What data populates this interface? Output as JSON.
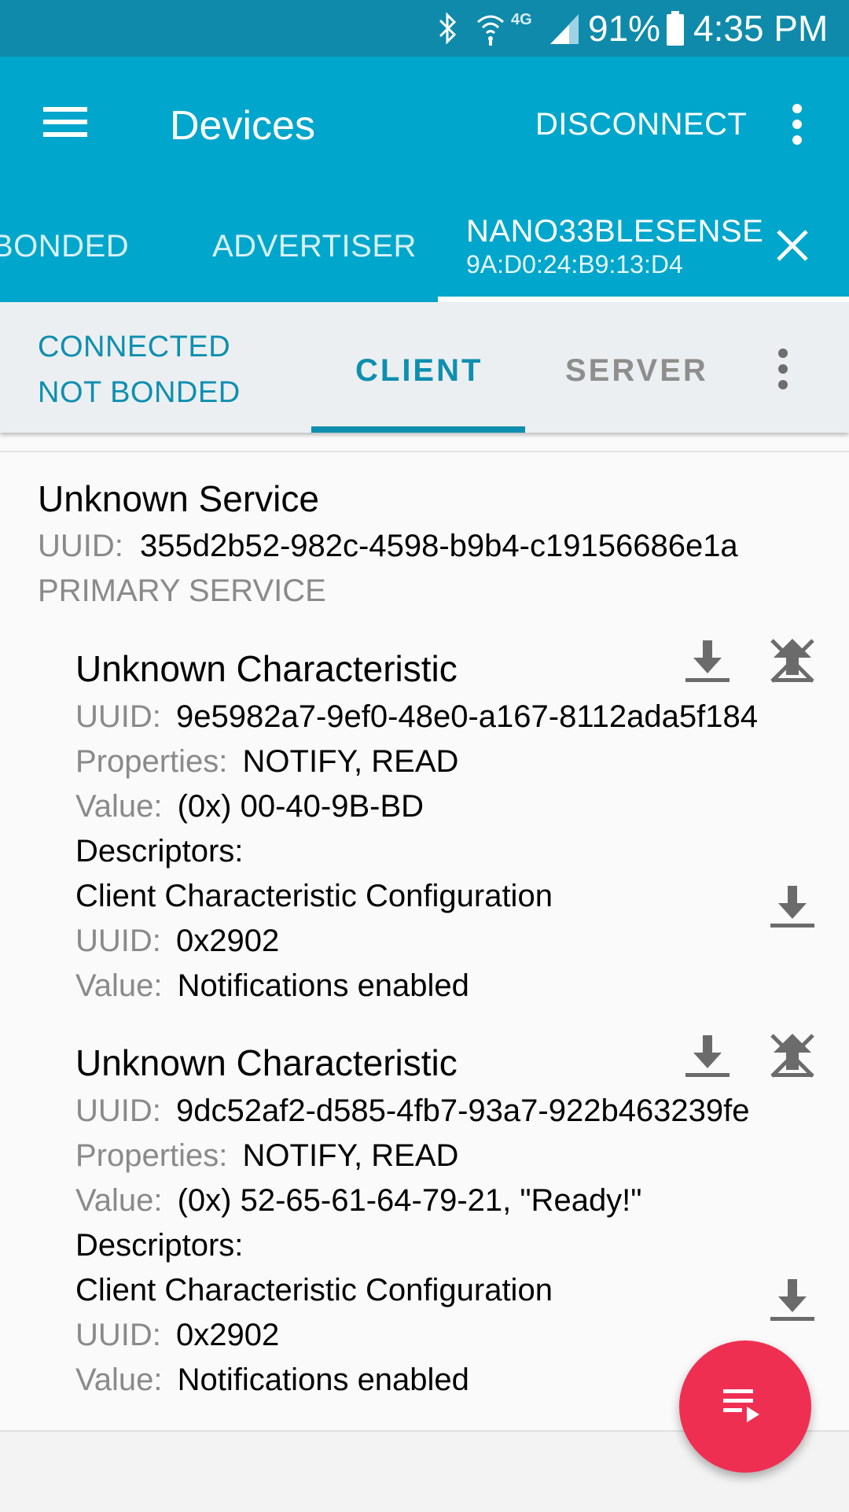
{
  "status": {
    "battery": "91%",
    "time": "4:35 PM",
    "network": "4G"
  },
  "toolbar": {
    "title": "Devices",
    "disconnect_label": "DISCONNECT"
  },
  "device_tabs": [
    {
      "label": "BONDED"
    },
    {
      "label": "ADVERTISER"
    },
    {
      "name": "NANO33BLESENSE",
      "address": "9A:D0:24:B9:13:D4",
      "active": true
    }
  ],
  "connection": {
    "state": "CONNECTED",
    "bond": "NOT BONDED"
  },
  "sub_tabs": [
    {
      "label": "CLIENT",
      "active": true
    },
    {
      "label": "SERVER",
      "active": false
    }
  ],
  "colors": {
    "status_bar": "#0f8aab",
    "app_bar": "#01a6cc",
    "accent": "#0e8fb0",
    "fab": "#ef2f52"
  },
  "service": {
    "name": "Unknown Service",
    "uuid_label": "UUID:",
    "uuid": "355d2b52-982c-4598-b9b4-c19156686e1a",
    "type": "PRIMARY SERVICE",
    "characteristics": [
      {
        "name": "Unknown Characteristic",
        "uuid_label": "UUID:",
        "uuid": "9e5982a7-9ef0-48e0-a167-8112ada5f184",
        "properties_label": "Properties:",
        "properties": "NOTIFY, READ",
        "value_label": "Value:",
        "value": "(0x) 00-40-9B-BD",
        "descriptors_label": "Descriptors:",
        "descriptor": {
          "name": "Client Characteristic Configuration",
          "uuid_label": "UUID:",
          "uuid": "0x2902",
          "value_label": "Value:",
          "value": "Notifications enabled"
        }
      },
      {
        "name": "Unknown Characteristic",
        "uuid_label": "UUID:",
        "uuid": "9dc52af2-d585-4fb7-93a7-922b463239fe",
        "properties_label": "Properties:",
        "properties": "NOTIFY, READ",
        "value_label": "Value:",
        "value": "(0x) 52-65-61-64-79-21, \"Ready!\"",
        "descriptors_label": "Descriptors:",
        "descriptor": {
          "name": "Client Characteristic Configuration",
          "uuid_label": "UUID:",
          "uuid": "0x2902",
          "value_label": "Value:",
          "value": "Notifications enabled"
        }
      }
    ]
  },
  "icons": [
    "bluetooth-icon",
    "wifi-icon",
    "signal-icon",
    "battery-icon",
    "menu-icon",
    "more-vert-icon",
    "close-icon",
    "download-icon",
    "notifications-off-icon",
    "playlist-play-icon"
  ]
}
